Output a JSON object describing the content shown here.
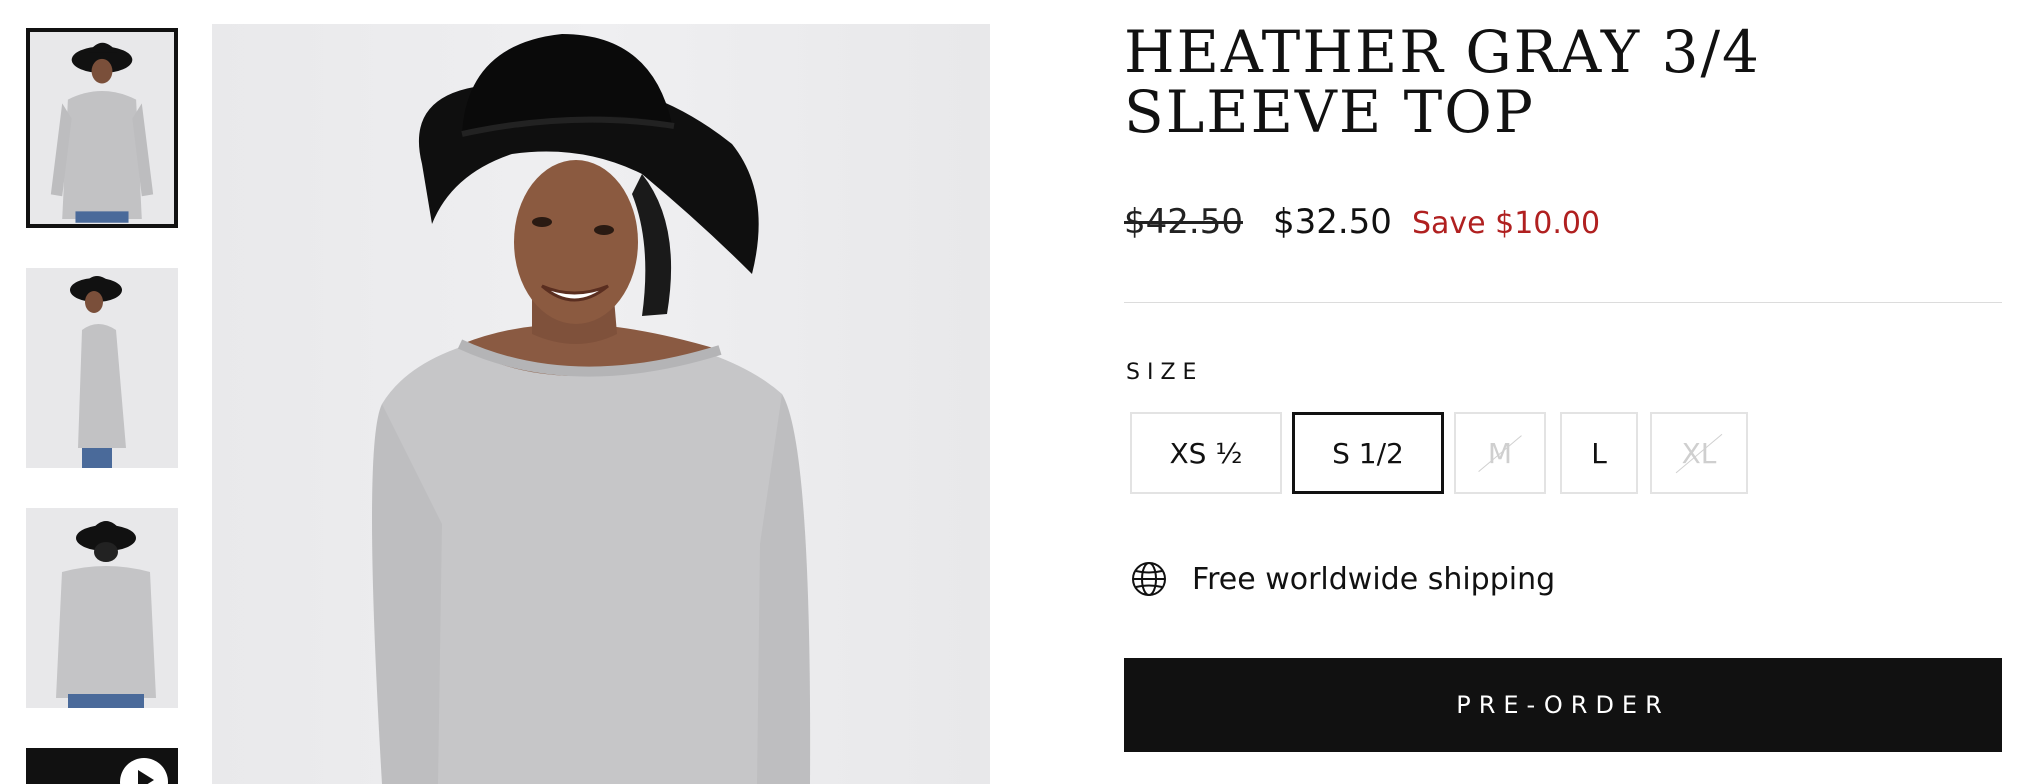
{
  "product": {
    "title": "HEATHER GRAY 3/4 SLEEVE TOP",
    "price_original": "$42.50",
    "price_sale": "$32.50",
    "price_savings": "Save $10.00"
  },
  "size": {
    "label": "SIZE",
    "options": [
      {
        "label": "XS  ½",
        "available": true,
        "selected": false
      },
      {
        "label": "S 1/2",
        "available": true,
        "selected": true
      },
      {
        "label": "M",
        "available": false,
        "selected": false
      },
      {
        "label": "L",
        "available": true,
        "selected": false
      },
      {
        "label": "XL",
        "available": false,
        "selected": false
      }
    ]
  },
  "shipping": {
    "icon": "globe-icon",
    "text": "Free worldwide shipping"
  },
  "cta": {
    "label": "PRE-ORDER"
  },
  "gallery": {
    "thumbnails": [
      "front-view",
      "side-view",
      "back-view",
      "video"
    ]
  },
  "colors": {
    "sale": "#b02020",
    "button": "#111111"
  }
}
